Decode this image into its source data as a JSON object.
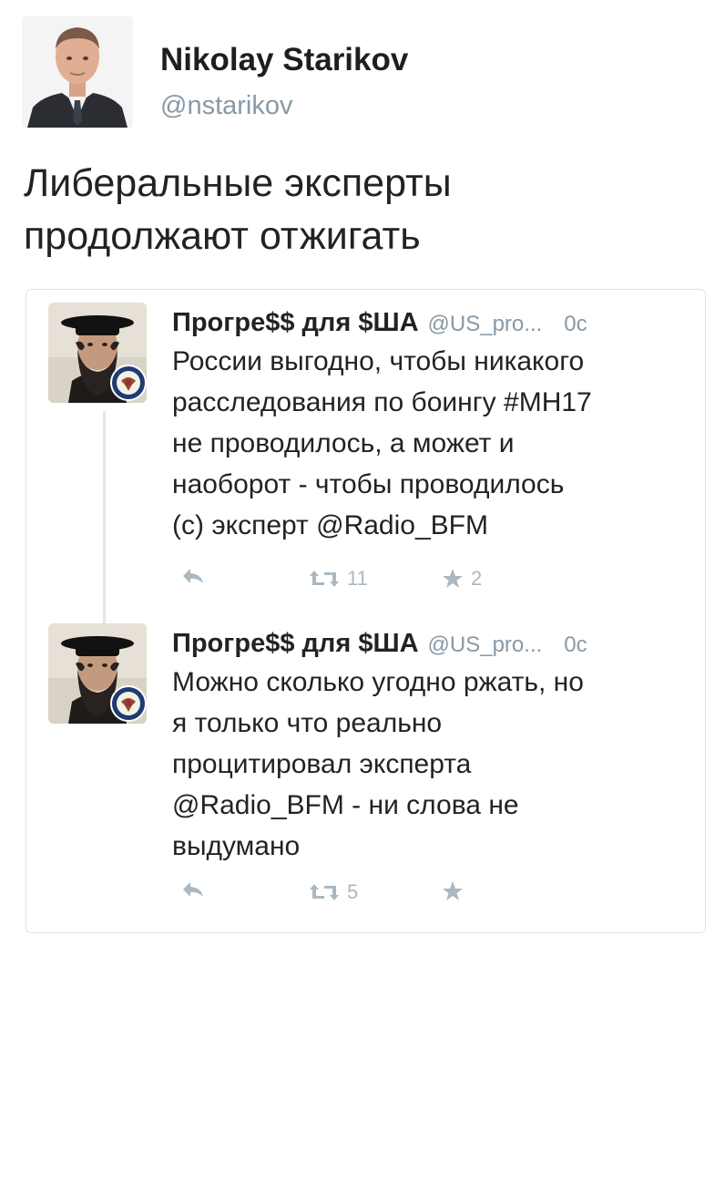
{
  "author": {
    "name": "Nikolay Starikov",
    "handle": "@nstarikov"
  },
  "tweet": {
    "text": "Либеральные эксперты\nпродолжают отжигать"
  },
  "quoted_tweets": [
    {
      "name": "Прогре$$ для $ША",
      "handle": "@US_pro...",
      "time": "0с",
      "body": "России выгодно, чтобы никакого\nрасследования по боингу #MH17\nне проводилось, а может и\nнаоборот - чтобы проводилось\n(с) эксперт @Radio_BFM",
      "retweets": "11",
      "favorites": "2"
    },
    {
      "name": "Прогре$$ для $ША",
      "handle": "@US_pro...",
      "time": "0с",
      "body": "Можно сколько угодно ржать, но\nя только что реально\nпроцитировал эксперта\n@Radio_BFM - ни слова не\nвыдумано",
      "retweets": "5",
      "favorites": ""
    }
  ],
  "icons": {
    "reply": "reply-icon",
    "retweet": "retweet-icon",
    "favorite": "star-icon",
    "seal": "department-of-state-seal-icon"
  },
  "colors": {
    "name": "#1f2326",
    "muted": "#8899a6",
    "action": "#aab8c2",
    "border": "#dde3e8"
  }
}
